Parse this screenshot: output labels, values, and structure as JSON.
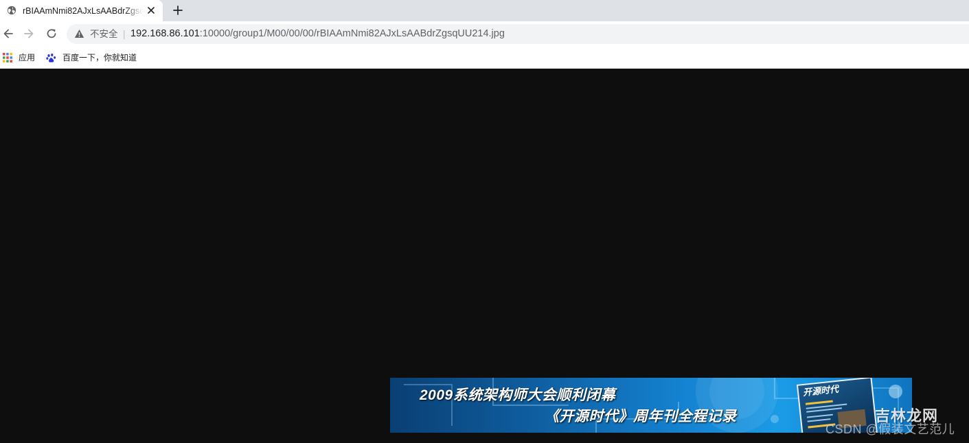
{
  "tab": {
    "title": "rBIAAmNmi82AJxLsAABdrZgsqUU214.jpg",
    "favicon": "globe-icon"
  },
  "toolbar": {
    "security_label": "不安全",
    "separator": "|",
    "url_host": "192.168.86.101",
    "url_rest": ":10000/group1/M00/00/00/rBIAAmNmi82AJxLsAABdrZgsqUU214.jpg"
  },
  "bookmarks": {
    "apps_label": "应用",
    "baidu_label": "百度一下，你就知道"
  },
  "image": {
    "banner_line1": "2009系统架构师大会顺利闭幕",
    "banner_line2": "《开源时代》周年刊全程记录",
    "magazine_title": "开源时代",
    "watermark_text": "CSDN @假装文艺范儿",
    "watermark_logo": "吉林龙网"
  },
  "colors": {
    "page_background": "#0e0e0e",
    "tabstrip": "#dee1e6",
    "omnibox": "#f1f3f4"
  }
}
